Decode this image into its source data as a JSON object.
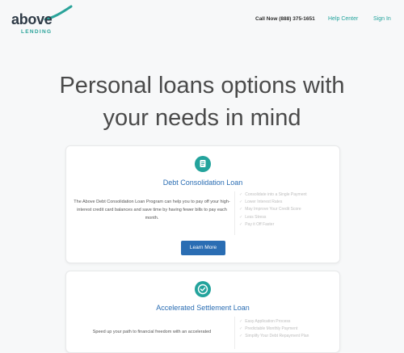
{
  "header": {
    "logo": {
      "word": "above",
      "sub": "LENDING"
    },
    "phone": "Call Now (888) 375-1651",
    "help_center": "Help Center",
    "sign_in": "Sign In"
  },
  "hero": {
    "title_line1": "Personal loans options with",
    "title_line2": "your needs in mind"
  },
  "cards": [
    {
      "icon": "document-icon",
      "title": "Debt Consolidation Loan",
      "description": "The Above Debt Consolidation Loan Program can help you to pay off your high-interest credit card balances and save time by having fewer bills to pay each month.",
      "features": [
        "Consolidate into a Single Payment",
        "Lower Interest Rates",
        "May Improve Your Credit Score",
        "Less Stress",
        "Pay it Off Faster"
      ],
      "button": "Learn More"
    },
    {
      "icon": "checkmark-icon",
      "title": "Accelerated Settlement Loan",
      "description": "Speed up your path to financial freedom with an accelerated",
      "features": [
        "Easy Application Process",
        "Predictable Monthly Payment",
        "Simplify Your Debt Repayment Plan"
      ]
    }
  ],
  "colors": {
    "brand_teal": "#23a39c",
    "brand_blue": "#2a6db3",
    "text_dark": "#4a4a4a"
  }
}
